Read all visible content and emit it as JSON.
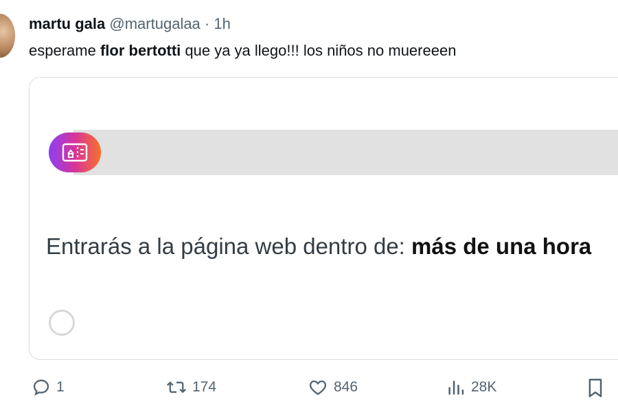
{
  "tweet": {
    "name": "martu gala",
    "handle": "@martugalaa",
    "separator": "·",
    "time": "1h",
    "text_before": "esperame ",
    "text_mention": "flor bertotti",
    "text_after": " que ya ya llego!!! los niños no muereeen"
  },
  "card": {
    "queue_label": "Entrarás a la página web dentro de: ",
    "queue_value": "más de una hora",
    "badge_icon": "ticket-icon",
    "badge_colors": [
      "#8a3ff5",
      "#d8349a",
      "#f7722c"
    ]
  },
  "actions": {
    "reply_count": "1",
    "retweet_count": "174",
    "like_count": "846",
    "views_count": "28K"
  }
}
